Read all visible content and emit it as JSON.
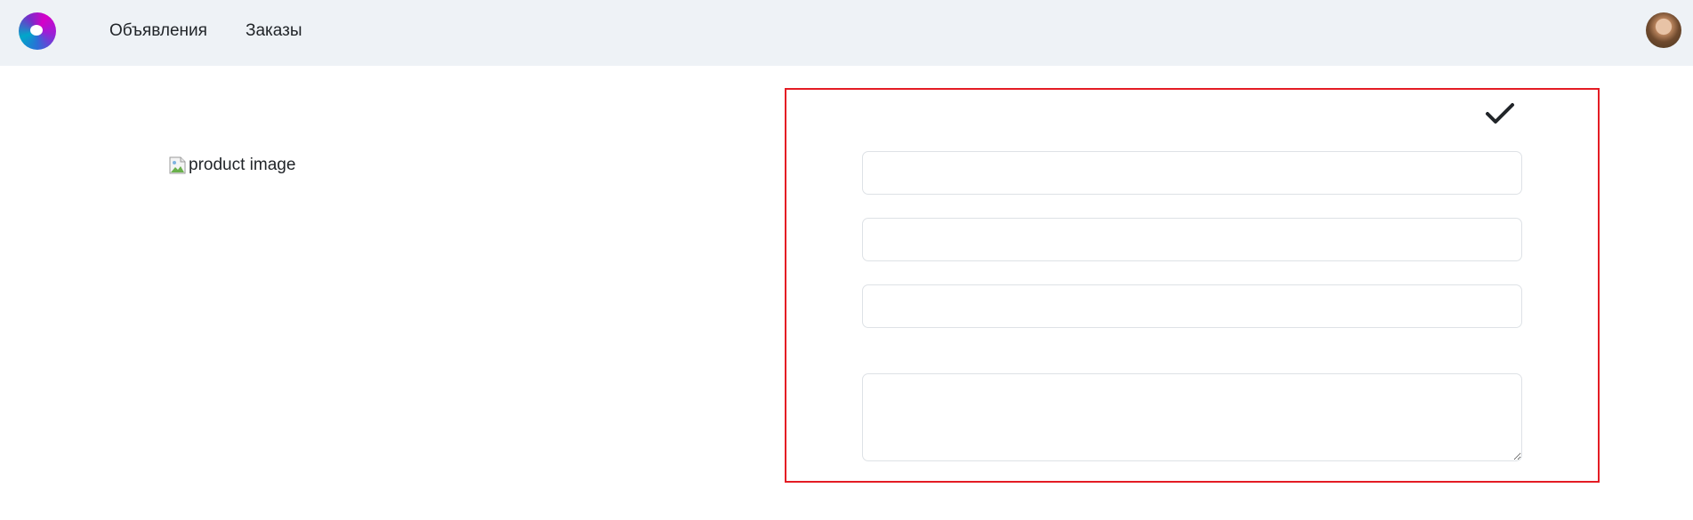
{
  "navbar": {
    "logo_icon": "app-logo-icon",
    "links": [
      {
        "label": "Объявления"
      },
      {
        "label": "Заказы"
      }
    ],
    "avatar_icon": "user-avatar"
  },
  "product": {
    "image_alt": "product image",
    "image_icon": "broken-image-icon"
  },
  "form": {
    "submit_icon": "checkmark-icon",
    "fields": [
      {
        "value": "",
        "placeholder": ""
      },
      {
        "value": "",
        "placeholder": ""
      },
      {
        "value": "",
        "placeholder": ""
      }
    ],
    "description": {
      "value": "",
      "placeholder": ""
    }
  },
  "colors": {
    "navbar_bg": "#eef2f6",
    "panel_border": "#e41c24",
    "text": "#212529",
    "input_border": "#dee2e6"
  }
}
